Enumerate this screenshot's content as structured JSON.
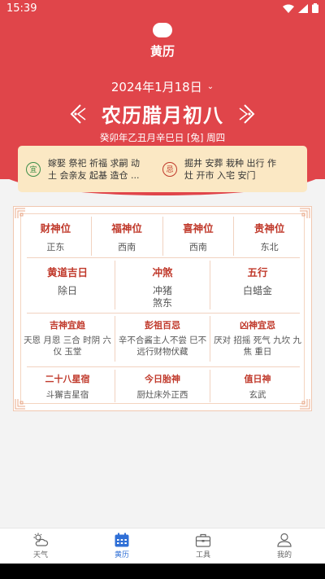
{
  "status": {
    "time": "15:39"
  },
  "header": {
    "title": "黄历",
    "date": "2024年1月18日",
    "lunar": "农历腊月初八",
    "ganzhi": "癸卯年乙丑月辛巳日 [兔] 周四"
  },
  "yiji": {
    "yi_badge": "宜",
    "yi_text": "嫁娶 祭祀 祈福 求嗣 动土 会亲友 起基 造仓 ...",
    "ji_badge": "忌",
    "ji_text": "掘井 安葬 栽种 出行 作灶 开市 入宅 安门"
  },
  "gods": [
    {
      "label": "财神位",
      "value": "正东"
    },
    {
      "label": "福神位",
      "value": "西南"
    },
    {
      "label": "喜神位",
      "value": "西南"
    },
    {
      "label": "贵神位",
      "value": "东北"
    }
  ],
  "row2": [
    {
      "label": "黄道吉日",
      "value": "除日"
    },
    {
      "label": "冲煞",
      "value": "冲猪\n煞东"
    },
    {
      "label": "五行",
      "value": "白蜡金"
    }
  ],
  "row3": [
    {
      "label": "吉神宜趋",
      "value": "天恩 月恩 三合 时阴 六仪 玉堂"
    },
    {
      "label": "彭祖百忌",
      "value": "辛不合酱主人不尝 巳不远行财物伏藏"
    },
    {
      "label": "凶神宜忌",
      "value": "厌对 招摇 死气 九坎 九焦 重日"
    }
  ],
  "row4": [
    {
      "label": "二十八星宿",
      "value": "斗獬吉星宿"
    },
    {
      "label": "今日胎神",
      "value": "厨灶床外正西"
    },
    {
      "label": "值日神",
      "value": "玄武"
    }
  ],
  "nav": [
    {
      "label": "天气",
      "icon": "weather-icon"
    },
    {
      "label": "黄历",
      "icon": "calendar-icon"
    },
    {
      "label": "工具",
      "icon": "toolbox-icon"
    },
    {
      "label": "我的",
      "icon": "profile-icon"
    }
  ],
  "colors": {
    "primary": "#e0454a",
    "accent_text": "#c0392b",
    "nav_active": "#2f6fd6",
    "card_bg": "#fbe8c4"
  }
}
